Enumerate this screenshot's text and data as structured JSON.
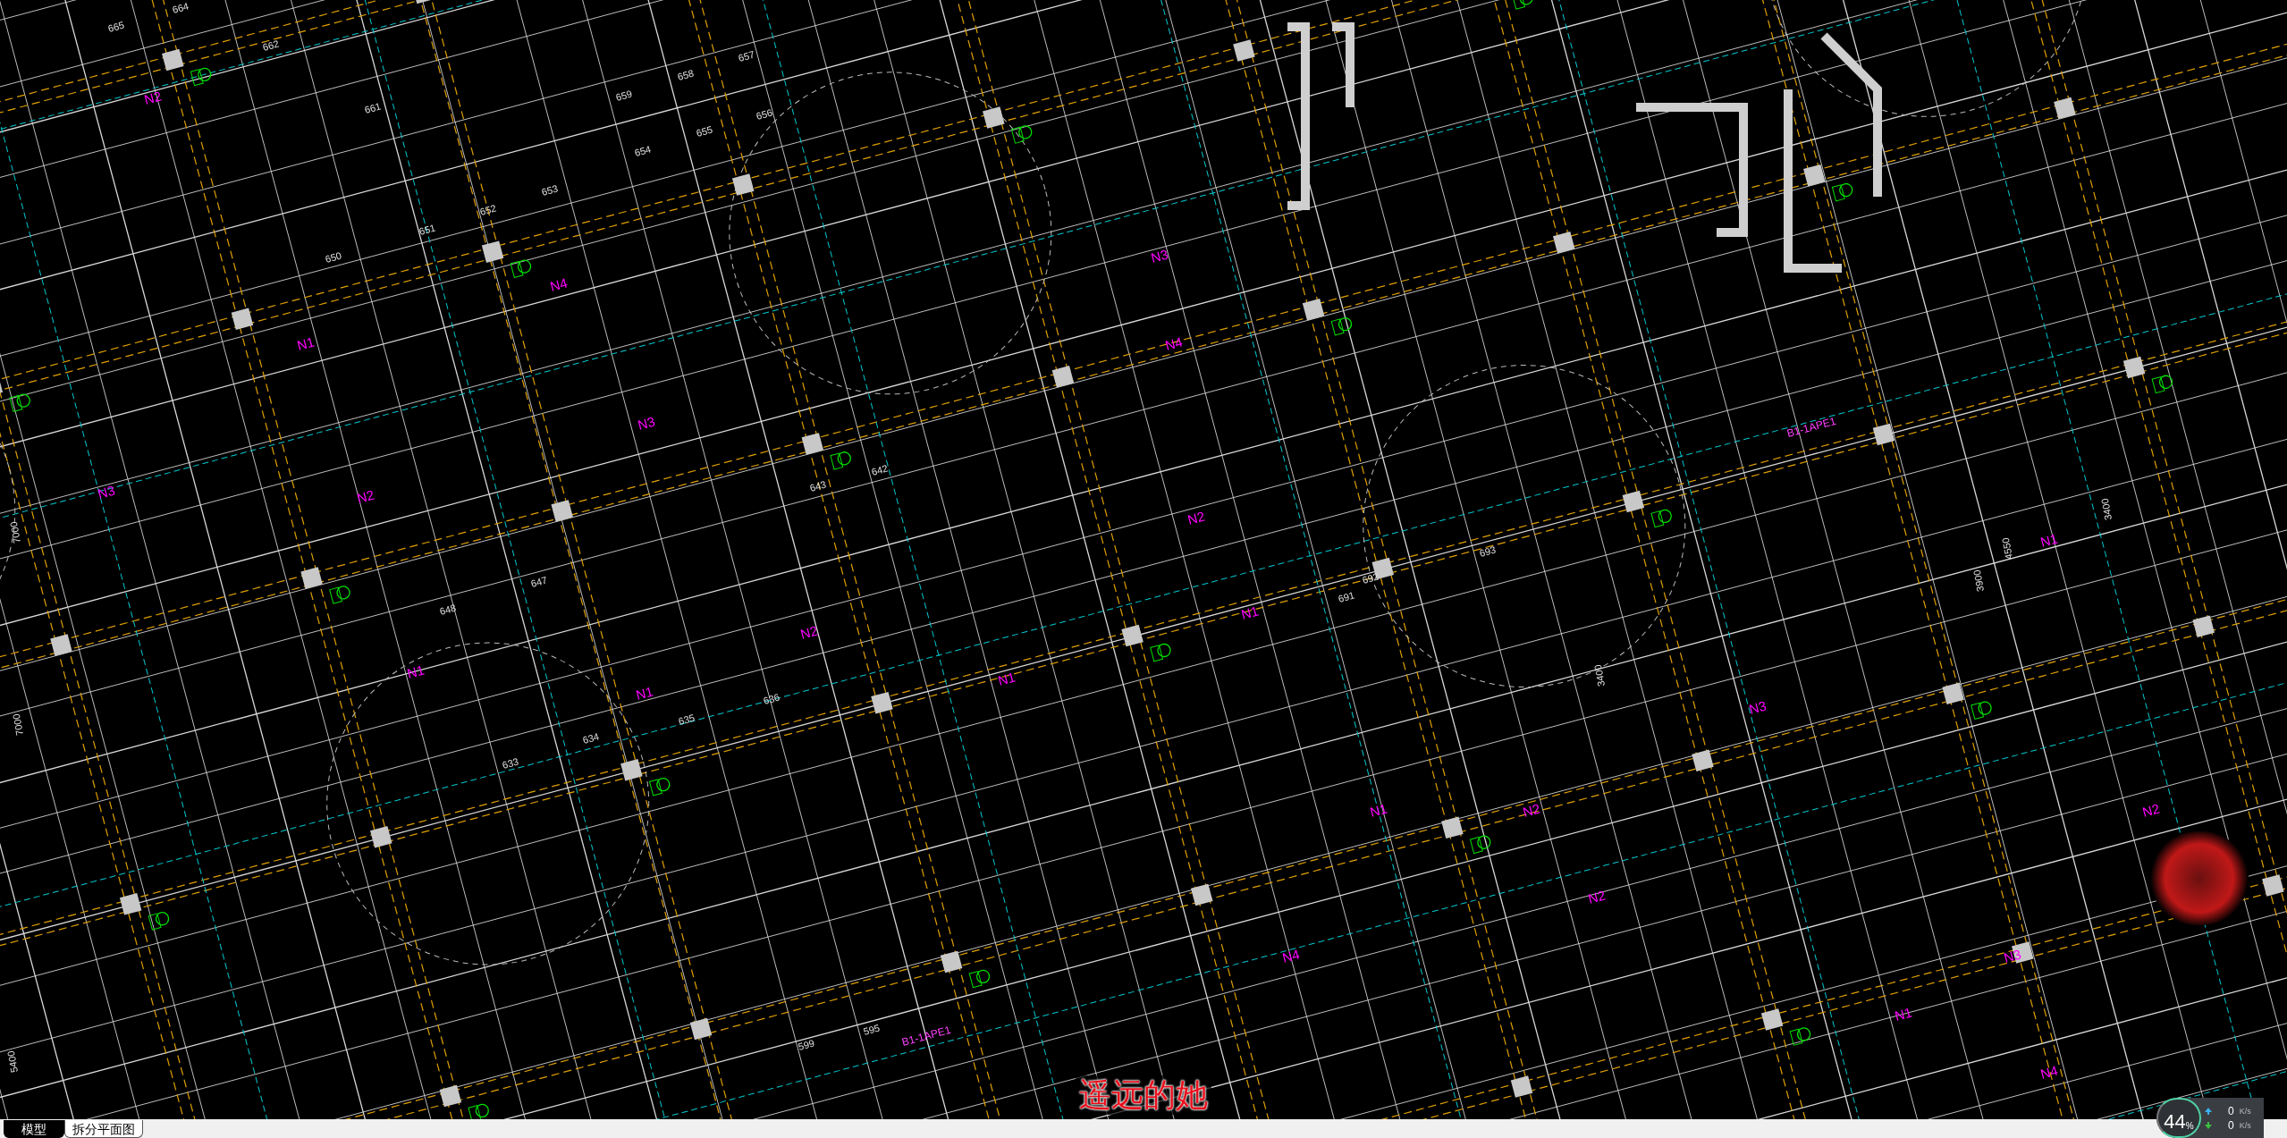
{
  "drawing": {
    "labels": [
      {
        "text": "N2",
        "kind": "pipe"
      },
      {
        "text": "N1",
        "kind": "pipe"
      },
      {
        "text": "N2",
        "kind": "pipe"
      },
      {
        "text": "N1",
        "kind": "pipe"
      },
      {
        "text": "N3",
        "kind": "pipe"
      },
      {
        "text": "N4",
        "kind": "pipe"
      },
      {
        "text": "N3",
        "kind": "pipe"
      },
      {
        "text": "N2",
        "kind": "pipe"
      },
      {
        "text": "N1",
        "kind": "pipe"
      },
      {
        "text": "N1",
        "kind": "pipe"
      },
      {
        "text": "N2",
        "kind": "pipe"
      },
      {
        "text": "N3",
        "kind": "pipe"
      },
      {
        "text": "N4",
        "kind": "pipe"
      },
      {
        "text": "N1",
        "kind": "pipe"
      },
      {
        "text": "N2",
        "kind": "pipe"
      },
      {
        "text": "N4",
        "kind": "pipe"
      },
      {
        "text": "N1",
        "kind": "pipe"
      },
      {
        "text": "N3",
        "kind": "pipe"
      },
      {
        "text": "N2",
        "kind": "pipe"
      },
      {
        "text": "N4",
        "kind": "pipe"
      },
      {
        "text": "N1",
        "kind": "pipe"
      },
      {
        "text": "N2",
        "kind": "pipe"
      },
      {
        "text": "N3",
        "kind": "pipe"
      },
      {
        "text": "N1",
        "kind": "pipe"
      },
      {
        "text": "665",
        "kind": "room"
      },
      {
        "text": "664",
        "kind": "room"
      },
      {
        "text": "662",
        "kind": "room"
      },
      {
        "text": "661",
        "kind": "room"
      },
      {
        "text": "650",
        "kind": "room"
      },
      {
        "text": "651",
        "kind": "room"
      },
      {
        "text": "652",
        "kind": "room"
      },
      {
        "text": "653",
        "kind": "room"
      },
      {
        "text": "654",
        "kind": "room"
      },
      {
        "text": "655",
        "kind": "room"
      },
      {
        "text": "656",
        "kind": "room"
      },
      {
        "text": "657",
        "kind": "room"
      },
      {
        "text": "658",
        "kind": "room"
      },
      {
        "text": "659",
        "kind": "room"
      },
      {
        "text": "633",
        "kind": "room"
      },
      {
        "text": "634",
        "kind": "room"
      },
      {
        "text": "635",
        "kind": "room"
      },
      {
        "text": "636",
        "kind": "room"
      },
      {
        "text": "648",
        "kind": "room"
      },
      {
        "text": "647",
        "kind": "room"
      },
      {
        "text": "643",
        "kind": "room"
      },
      {
        "text": "642",
        "kind": "room"
      },
      {
        "text": "691",
        "kind": "room"
      },
      {
        "text": "692",
        "kind": "room"
      },
      {
        "text": "693",
        "kind": "room"
      },
      {
        "text": "599",
        "kind": "room"
      },
      {
        "text": "595",
        "kind": "room"
      },
      {
        "text": "7000",
        "kind": "dimension"
      },
      {
        "text": "7000",
        "kind": "dimension"
      },
      {
        "text": "5400",
        "kind": "dimension"
      },
      {
        "text": "4550",
        "kind": "dimension"
      },
      {
        "text": "3900",
        "kind": "dimension"
      },
      {
        "text": "3400",
        "kind": "dimension"
      },
      {
        "text": "3400",
        "kind": "dimension"
      },
      {
        "text": "B1-1APE1",
        "kind": "tag"
      },
      {
        "text": "B1-1APE1",
        "kind": "tag"
      }
    ]
  },
  "subtitle": "遥远的她",
  "tabs": [
    {
      "label": "模型",
      "selected": true
    },
    {
      "label": "拆分平面图",
      "selected": false
    }
  ],
  "speed_widget": {
    "percent": "44",
    "percent_unit": "%",
    "upload": "0",
    "upload_unit": "K/s",
    "download": "0",
    "download_unit": "K/s"
  }
}
